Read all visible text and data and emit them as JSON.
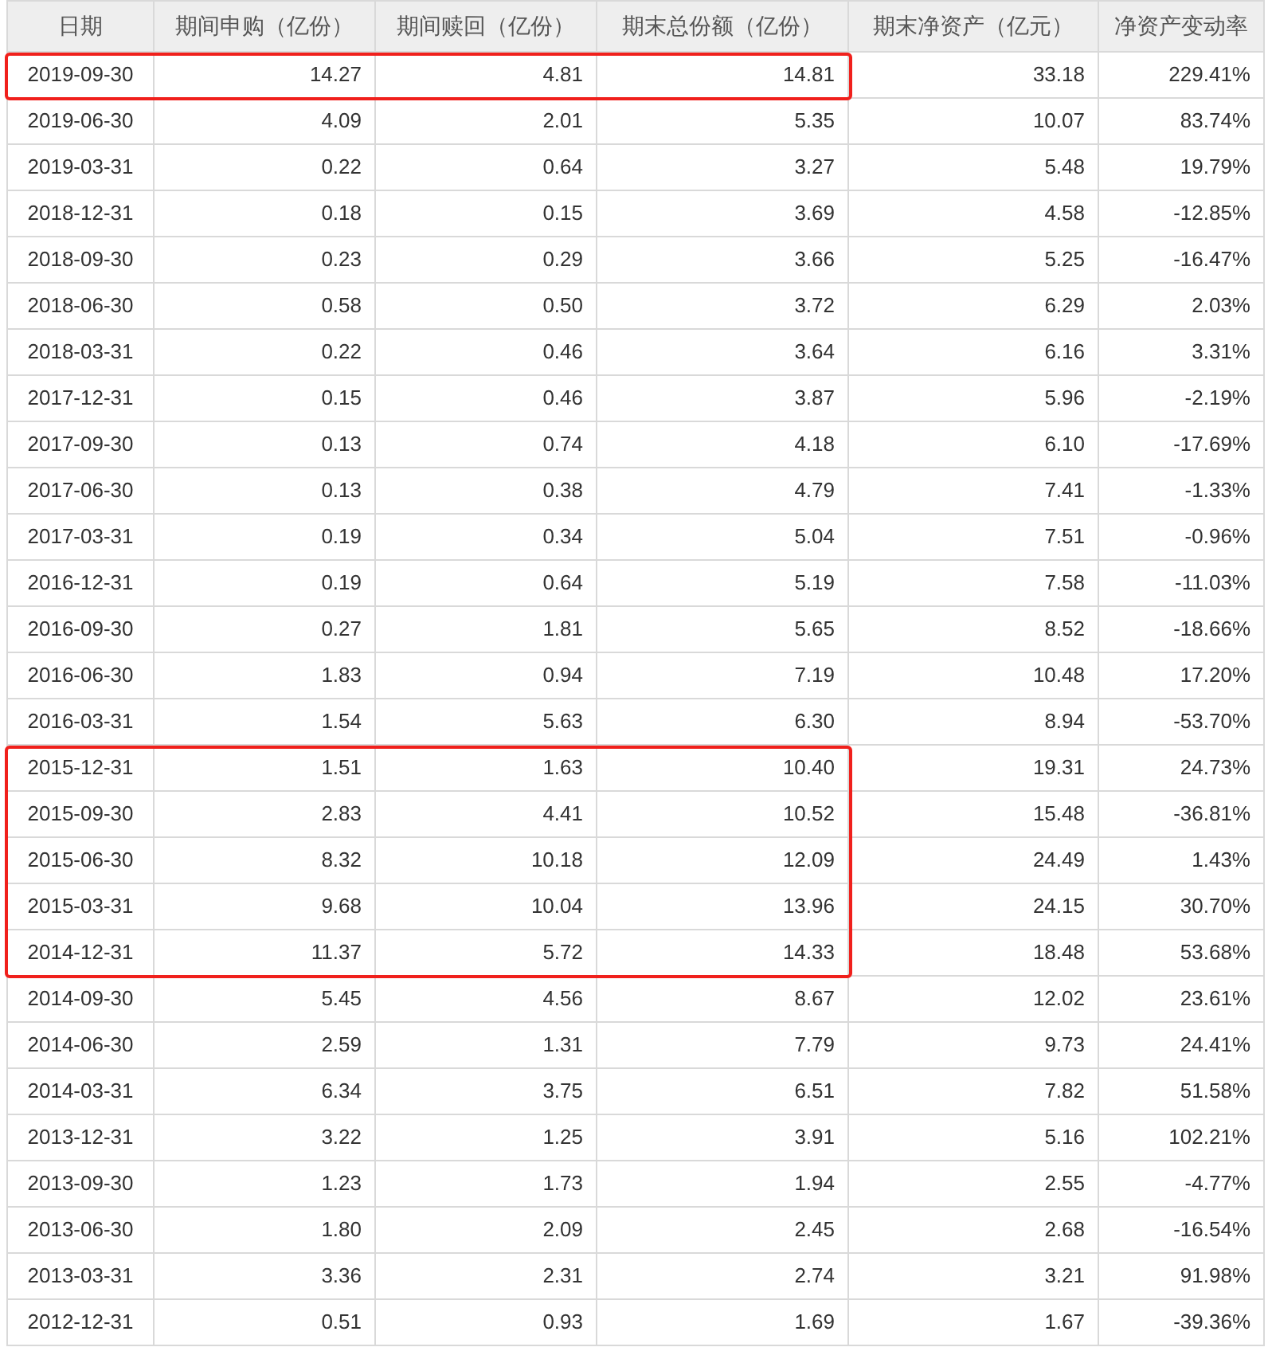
{
  "table": {
    "columns": [
      {
        "label": "日期"
      },
      {
        "label": "期间申购（亿份）"
      },
      {
        "label": "期间赎回（亿份）"
      },
      {
        "label": "期末总份额（亿份）"
      },
      {
        "label": "期末净资产（亿元）"
      },
      {
        "label": "净资产变动率"
      }
    ],
    "rows": [
      {
        "cells": [
          "2019-09-30",
          "14.27",
          "4.81",
          "14.81",
          "33.18",
          "229.41%"
        ],
        "boxed": true
      },
      {
        "cells": [
          "2019-06-30",
          "4.09",
          "2.01",
          "5.35",
          "10.07",
          "83.74%"
        ],
        "boxed": false
      },
      {
        "cells": [
          "2019-03-31",
          "0.22",
          "0.64",
          "3.27",
          "5.48",
          "19.79%"
        ],
        "boxed": false
      },
      {
        "cells": [
          "2018-12-31",
          "0.18",
          "0.15",
          "3.69",
          "4.58",
          "-12.85%"
        ],
        "boxed": false
      },
      {
        "cells": [
          "2018-09-30",
          "0.23",
          "0.29",
          "3.66",
          "5.25",
          "-16.47%"
        ],
        "boxed": false
      },
      {
        "cells": [
          "2018-06-30",
          "0.58",
          "0.50",
          "3.72",
          "6.29",
          "2.03%"
        ],
        "boxed": false
      },
      {
        "cells": [
          "2018-03-31",
          "0.22",
          "0.46",
          "3.64",
          "6.16",
          "3.31%"
        ],
        "boxed": false
      },
      {
        "cells": [
          "2017-12-31",
          "0.15",
          "0.46",
          "3.87",
          "5.96",
          "-2.19%"
        ],
        "boxed": false
      },
      {
        "cells": [
          "2017-09-30",
          "0.13",
          "0.74",
          "4.18",
          "6.10",
          "-17.69%"
        ],
        "boxed": false
      },
      {
        "cells": [
          "2017-06-30",
          "0.13",
          "0.38",
          "4.79",
          "7.41",
          "-1.33%"
        ],
        "boxed": false
      },
      {
        "cells": [
          "2017-03-31",
          "0.19",
          "0.34",
          "5.04",
          "7.51",
          "-0.96%"
        ],
        "boxed": false
      },
      {
        "cells": [
          "2016-12-31",
          "0.19",
          "0.64",
          "5.19",
          "7.58",
          "-11.03%"
        ],
        "boxed": false
      },
      {
        "cells": [
          "2016-09-30",
          "0.27",
          "1.81",
          "5.65",
          "8.52",
          "-18.66%"
        ],
        "boxed": false
      },
      {
        "cells": [
          "2016-06-30",
          "1.83",
          "0.94",
          "7.19",
          "10.48",
          "17.20%"
        ],
        "boxed": false
      },
      {
        "cells": [
          "2016-03-31",
          "1.54",
          "5.63",
          "6.30",
          "8.94",
          "-53.70%"
        ],
        "boxed": false
      },
      {
        "cells": [
          "2015-12-31",
          "1.51",
          "1.63",
          "10.40",
          "19.31",
          "24.73%"
        ],
        "boxed": true
      },
      {
        "cells": [
          "2015-09-30",
          "2.83",
          "4.41",
          "10.52",
          "15.48",
          "-36.81%"
        ],
        "boxed": true
      },
      {
        "cells": [
          "2015-06-30",
          "8.32",
          "10.18",
          "12.09",
          "24.49",
          "1.43%"
        ],
        "boxed": true
      },
      {
        "cells": [
          "2015-03-31",
          "9.68",
          "10.04",
          "13.96",
          "24.15",
          "30.70%"
        ],
        "boxed": true
      },
      {
        "cells": [
          "2014-12-31",
          "11.37",
          "5.72",
          "14.33",
          "18.48",
          "53.68%"
        ],
        "boxed": true
      },
      {
        "cells": [
          "2014-09-30",
          "5.45",
          "4.56",
          "8.67",
          "12.02",
          "23.61%"
        ],
        "boxed": false
      },
      {
        "cells": [
          "2014-06-30",
          "2.59",
          "1.31",
          "7.79",
          "9.73",
          "24.41%"
        ],
        "boxed": false
      },
      {
        "cells": [
          "2014-03-31",
          "6.34",
          "3.75",
          "6.51",
          "7.82",
          "51.58%"
        ],
        "boxed": false
      },
      {
        "cells": [
          "2013-12-31",
          "3.22",
          "1.25",
          "3.91",
          "5.16",
          "102.21%"
        ],
        "boxed": false
      },
      {
        "cells": [
          "2013-09-30",
          "1.23",
          "1.73",
          "1.94",
          "2.55",
          "-4.77%"
        ],
        "boxed": false
      },
      {
        "cells": [
          "2013-06-30",
          "1.80",
          "2.09",
          "2.45",
          "2.68",
          "-16.54%"
        ],
        "boxed": false
      },
      {
        "cells": [
          "2013-03-31",
          "3.36",
          "2.31",
          "2.74",
          "3.21",
          "91.98%"
        ],
        "boxed": false
      },
      {
        "cells": [
          "2012-12-31",
          "0.51",
          "0.93",
          "1.69",
          "1.67",
          "-39.36%"
        ],
        "boxed": false
      }
    ]
  }
}
